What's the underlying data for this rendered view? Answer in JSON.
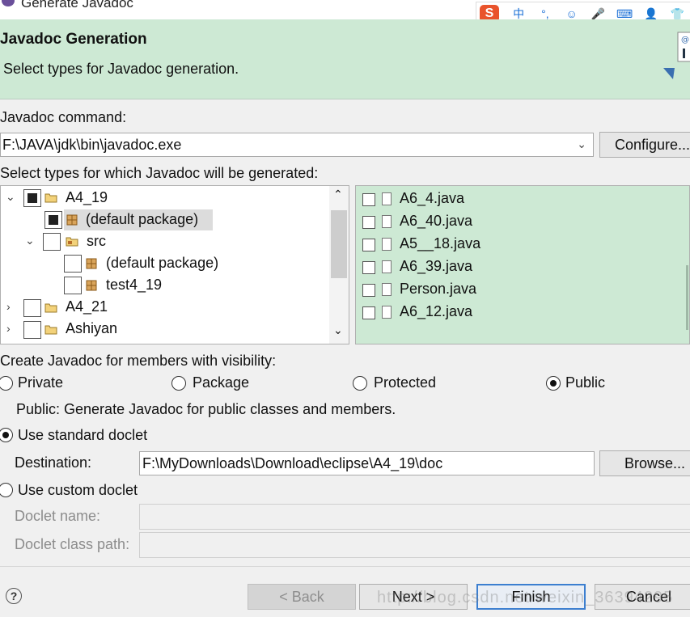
{
  "window": {
    "title": "Generate Javadoc"
  },
  "ime_toolbar": {
    "logo": "S",
    "items": [
      "中",
      "°,",
      "☺",
      "🎤",
      "⌨",
      "👤",
      "👕"
    ]
  },
  "header": {
    "title": "Javadoc Generation",
    "subtitle": "Select types for Javadoc generation."
  },
  "command": {
    "label": "Javadoc command:",
    "value": "F:\\JAVA\\jdk\\bin\\javadoc.exe",
    "configure_button": "Configure..."
  },
  "types": {
    "label": "Select types for which Javadoc will be generated:",
    "tree": [
      {
        "label": "A4_19",
        "state": "partial",
        "expanded": true,
        "icon": "project-icon"
      },
      {
        "label": "(default package)",
        "state": "partial",
        "icon": "package-icon",
        "selected": true
      },
      {
        "label": "src",
        "state": "unchecked",
        "expanded": true,
        "icon": "source-folder-icon"
      },
      {
        "label": "(default package)",
        "state": "unchecked",
        "icon": "package-icon"
      },
      {
        "label": "test4_19",
        "state": "unchecked",
        "icon": "package-icon"
      },
      {
        "label": "A4_21",
        "state": "unchecked",
        "expanded": false,
        "icon": "project-icon"
      },
      {
        "label": "Ashiyan",
        "state": "unchecked",
        "expanded": false,
        "icon": "project-icon"
      }
    ],
    "files": [
      "A6_4.java",
      "A6_40.java",
      "A5__18.java",
      "A6_39.java",
      "Person.java",
      "A6_12.java"
    ]
  },
  "visibility": {
    "label": "Create Javadoc for members with visibility:",
    "options": [
      "Private",
      "Package",
      "Protected",
      "Public"
    ],
    "selected": "Public",
    "description": "Public: Generate Javadoc for public classes and members."
  },
  "doclet": {
    "standard_label": "Use standard doclet",
    "standard_selected": true,
    "destination_label": "Destination:",
    "destination_value": "F:\\MyDownloads\\Download\\eclipse\\A4_19\\doc",
    "browse_button": "Browse...",
    "custom_label": "Use custom doclet",
    "doclet_name_label": "Doclet name:",
    "doclet_name_value": "",
    "doclet_classpath_label": "Doclet class path:",
    "doclet_classpath_value": ""
  },
  "footer": {
    "help": "?",
    "back_button": "< Back",
    "next_button": "Next >",
    "finish_button": "Finish",
    "cancel_button": "Cancel",
    "watermark": "http://blog.csdn.net/weixin_36394295"
  }
}
